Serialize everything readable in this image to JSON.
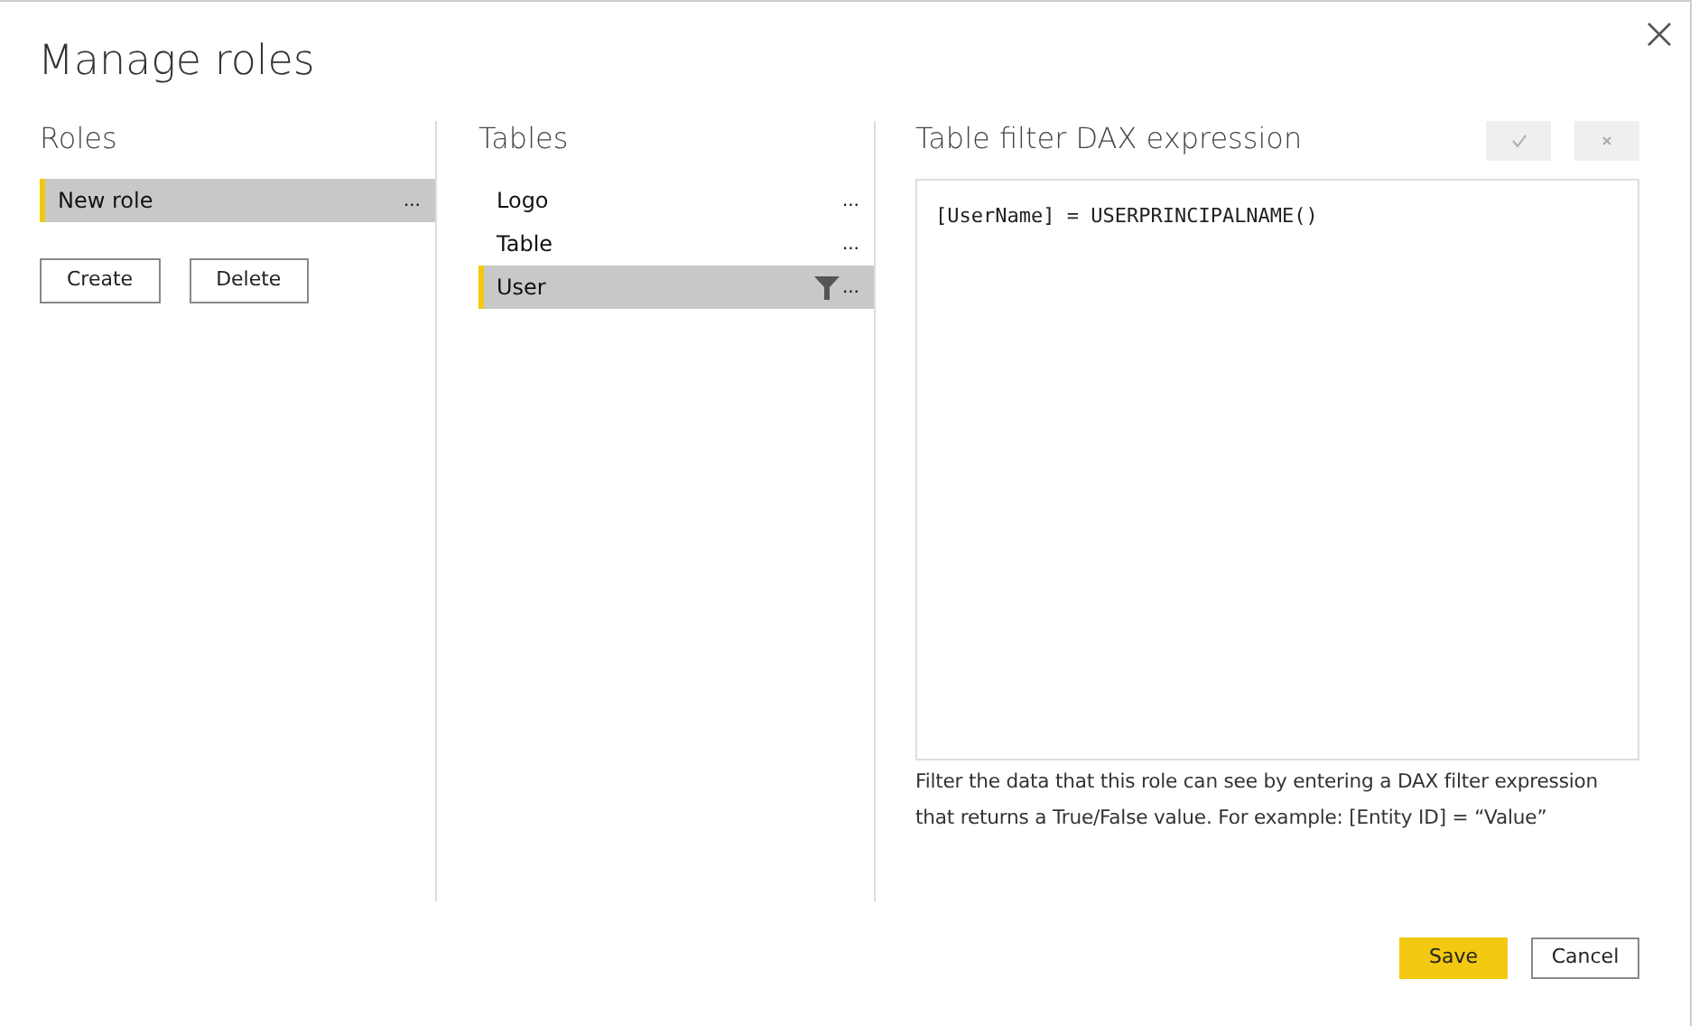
{
  "dialog": {
    "title": "Manage roles"
  },
  "roles": {
    "heading": "Roles",
    "items": [
      {
        "label": "New role",
        "more": "...",
        "selected": true
      }
    ],
    "buttons": [
      "Create",
      "Delete"
    ]
  },
  "tables": {
    "heading": "Tables",
    "items": [
      {
        "label": "Logo",
        "more": "...",
        "selected": false,
        "filtered": false
      },
      {
        "label": "Table",
        "more": "...",
        "selected": false,
        "filtered": false
      },
      {
        "label": "User",
        "more": "...",
        "selected": true,
        "filtered": true
      }
    ]
  },
  "filter": {
    "heading": "Table filter DAX expression",
    "accept_disabled": true,
    "cancel_disabled": true,
    "expression": "[UserName] = USERPRINCIPALNAME()",
    "help": "Filter the data that this role can see by entering a DAX filter expression that returns a True/False value. For example: [Entity ID] = “Value”"
  },
  "footer": {
    "buttons": [
      {
        "label": "Save",
        "kind": "primary"
      },
      {
        "label": "Cancel",
        "kind": "secondary"
      }
    ]
  }
}
